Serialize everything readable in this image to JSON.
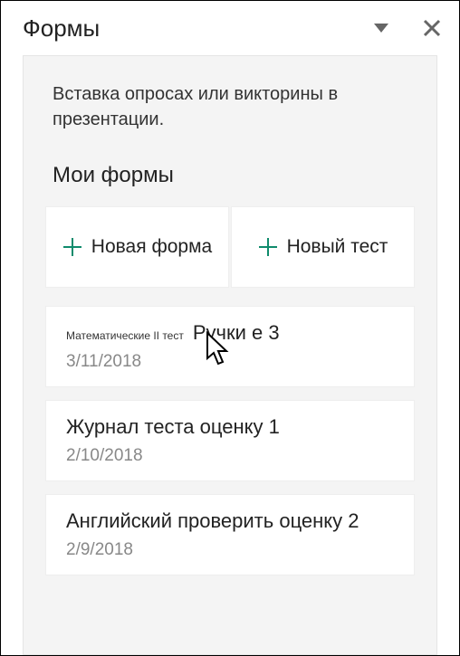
{
  "header": {
    "title": "Формы"
  },
  "intro": "Вставка опросах или викторины в презентации.",
  "section_title": "Мои формы",
  "new_buttons": {
    "new_form": "Новая форма",
    "new_quiz": "Новый тест"
  },
  "forms": [
    {
      "prefix": "Математические II тест",
      "title": "Ручки е 3",
      "date": "3/11/2018"
    },
    {
      "prefix": "",
      "title": "Журнал теста оценку 1",
      "date": "2/10/2018"
    },
    {
      "prefix": "",
      "title": "Английский проверить оценку 2",
      "date": "2/9/2018"
    }
  ],
  "icons": {
    "dropdown": "▼",
    "close": "✕",
    "plus": "+"
  }
}
